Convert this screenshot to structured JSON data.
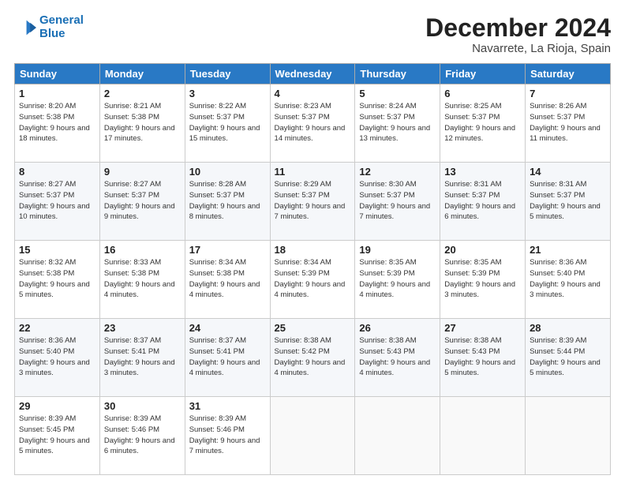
{
  "header": {
    "logo_line1": "General",
    "logo_line2": "Blue",
    "month": "December 2024",
    "location": "Navarrete, La Rioja, Spain"
  },
  "weekdays": [
    "Sunday",
    "Monday",
    "Tuesday",
    "Wednesday",
    "Thursday",
    "Friday",
    "Saturday"
  ],
  "weeks": [
    [
      {
        "day": "1",
        "sunrise": "Sunrise: 8:20 AM",
        "sunset": "Sunset: 5:38 PM",
        "daylight": "Daylight: 9 hours and 18 minutes."
      },
      {
        "day": "2",
        "sunrise": "Sunrise: 8:21 AM",
        "sunset": "Sunset: 5:38 PM",
        "daylight": "Daylight: 9 hours and 17 minutes."
      },
      {
        "day": "3",
        "sunrise": "Sunrise: 8:22 AM",
        "sunset": "Sunset: 5:37 PM",
        "daylight": "Daylight: 9 hours and 15 minutes."
      },
      {
        "day": "4",
        "sunrise": "Sunrise: 8:23 AM",
        "sunset": "Sunset: 5:37 PM",
        "daylight": "Daylight: 9 hours and 14 minutes."
      },
      {
        "day": "5",
        "sunrise": "Sunrise: 8:24 AM",
        "sunset": "Sunset: 5:37 PM",
        "daylight": "Daylight: 9 hours and 13 minutes."
      },
      {
        "day": "6",
        "sunrise": "Sunrise: 8:25 AM",
        "sunset": "Sunset: 5:37 PM",
        "daylight": "Daylight: 9 hours and 12 minutes."
      },
      {
        "day": "7",
        "sunrise": "Sunrise: 8:26 AM",
        "sunset": "Sunset: 5:37 PM",
        "daylight": "Daylight: 9 hours and 11 minutes."
      }
    ],
    [
      {
        "day": "8",
        "sunrise": "Sunrise: 8:27 AM",
        "sunset": "Sunset: 5:37 PM",
        "daylight": "Daylight: 9 hours and 10 minutes."
      },
      {
        "day": "9",
        "sunrise": "Sunrise: 8:27 AM",
        "sunset": "Sunset: 5:37 PM",
        "daylight": "Daylight: 9 hours and 9 minutes."
      },
      {
        "day": "10",
        "sunrise": "Sunrise: 8:28 AM",
        "sunset": "Sunset: 5:37 PM",
        "daylight": "Daylight: 9 hours and 8 minutes."
      },
      {
        "day": "11",
        "sunrise": "Sunrise: 8:29 AM",
        "sunset": "Sunset: 5:37 PM",
        "daylight": "Daylight: 9 hours and 7 minutes."
      },
      {
        "day": "12",
        "sunrise": "Sunrise: 8:30 AM",
        "sunset": "Sunset: 5:37 PM",
        "daylight": "Daylight: 9 hours and 7 minutes."
      },
      {
        "day": "13",
        "sunrise": "Sunrise: 8:31 AM",
        "sunset": "Sunset: 5:37 PM",
        "daylight": "Daylight: 9 hours and 6 minutes."
      },
      {
        "day": "14",
        "sunrise": "Sunrise: 8:31 AM",
        "sunset": "Sunset: 5:37 PM",
        "daylight": "Daylight: 9 hours and 5 minutes."
      }
    ],
    [
      {
        "day": "15",
        "sunrise": "Sunrise: 8:32 AM",
        "sunset": "Sunset: 5:38 PM",
        "daylight": "Daylight: 9 hours and 5 minutes."
      },
      {
        "day": "16",
        "sunrise": "Sunrise: 8:33 AM",
        "sunset": "Sunset: 5:38 PM",
        "daylight": "Daylight: 9 hours and 4 minutes."
      },
      {
        "day": "17",
        "sunrise": "Sunrise: 8:34 AM",
        "sunset": "Sunset: 5:38 PM",
        "daylight": "Daylight: 9 hours and 4 minutes."
      },
      {
        "day": "18",
        "sunrise": "Sunrise: 8:34 AM",
        "sunset": "Sunset: 5:39 PM",
        "daylight": "Daylight: 9 hours and 4 minutes."
      },
      {
        "day": "19",
        "sunrise": "Sunrise: 8:35 AM",
        "sunset": "Sunset: 5:39 PM",
        "daylight": "Daylight: 9 hours and 4 minutes."
      },
      {
        "day": "20",
        "sunrise": "Sunrise: 8:35 AM",
        "sunset": "Sunset: 5:39 PM",
        "daylight": "Daylight: 9 hours and 3 minutes."
      },
      {
        "day": "21",
        "sunrise": "Sunrise: 8:36 AM",
        "sunset": "Sunset: 5:40 PM",
        "daylight": "Daylight: 9 hours and 3 minutes."
      }
    ],
    [
      {
        "day": "22",
        "sunrise": "Sunrise: 8:36 AM",
        "sunset": "Sunset: 5:40 PM",
        "daylight": "Daylight: 9 hours and 3 minutes."
      },
      {
        "day": "23",
        "sunrise": "Sunrise: 8:37 AM",
        "sunset": "Sunset: 5:41 PM",
        "daylight": "Daylight: 9 hours and 3 minutes."
      },
      {
        "day": "24",
        "sunrise": "Sunrise: 8:37 AM",
        "sunset": "Sunset: 5:41 PM",
        "daylight": "Daylight: 9 hours and 4 minutes."
      },
      {
        "day": "25",
        "sunrise": "Sunrise: 8:38 AM",
        "sunset": "Sunset: 5:42 PM",
        "daylight": "Daylight: 9 hours and 4 minutes."
      },
      {
        "day": "26",
        "sunrise": "Sunrise: 8:38 AM",
        "sunset": "Sunset: 5:43 PM",
        "daylight": "Daylight: 9 hours and 4 minutes."
      },
      {
        "day": "27",
        "sunrise": "Sunrise: 8:38 AM",
        "sunset": "Sunset: 5:43 PM",
        "daylight": "Daylight: 9 hours and 5 minutes."
      },
      {
        "day": "28",
        "sunrise": "Sunrise: 8:39 AM",
        "sunset": "Sunset: 5:44 PM",
        "daylight": "Daylight: 9 hours and 5 minutes."
      }
    ],
    [
      {
        "day": "29",
        "sunrise": "Sunrise: 8:39 AM",
        "sunset": "Sunset: 5:45 PM",
        "daylight": "Daylight: 9 hours and 5 minutes."
      },
      {
        "day": "30",
        "sunrise": "Sunrise: 8:39 AM",
        "sunset": "Sunset: 5:46 PM",
        "daylight": "Daylight: 9 hours and 6 minutes."
      },
      {
        "day": "31",
        "sunrise": "Sunrise: 8:39 AM",
        "sunset": "Sunset: 5:46 PM",
        "daylight": "Daylight: 9 hours and 7 minutes."
      },
      null,
      null,
      null,
      null
    ]
  ]
}
